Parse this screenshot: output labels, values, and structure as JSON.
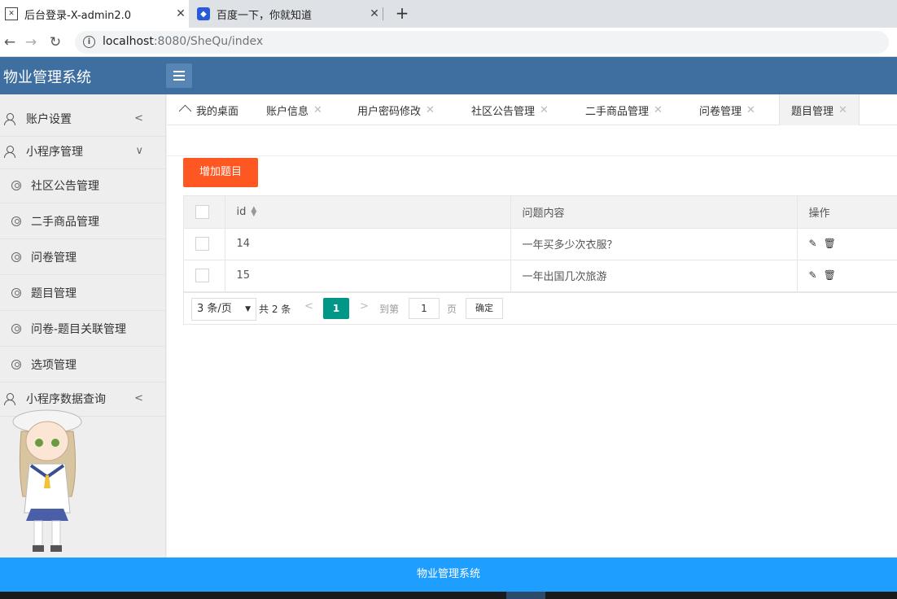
{
  "browser": {
    "tabs": [
      {
        "title": "后台登录-X-admin2.0",
        "icon": "x-icon",
        "active": true
      },
      {
        "title": "百度一下，你就知道",
        "icon": "paw-icon",
        "active": false
      }
    ],
    "close_glyph": "✕",
    "new_tab_glyph": "+",
    "url_host": "localhost",
    "url_path": ":8080/SheQu/index"
  },
  "header": {
    "title": "物业管理系统"
  },
  "sidebar": {
    "items": [
      {
        "label": "账户设置",
        "type": "group",
        "arrow": "<"
      },
      {
        "label": "小程序管理",
        "type": "group",
        "arrow": "∨"
      },
      {
        "label": "社区公告管理",
        "type": "sub"
      },
      {
        "label": "二手商品管理",
        "type": "sub"
      },
      {
        "label": "问卷管理",
        "type": "sub"
      },
      {
        "label": "题目管理",
        "type": "sub"
      },
      {
        "label": "问卷-题目关联管理",
        "type": "sub"
      },
      {
        "label": "选项管理",
        "type": "sub"
      },
      {
        "label": "小程序数据查询",
        "type": "group",
        "arrow": "<"
      }
    ]
  },
  "content_tabs": [
    {
      "label": "我的桌面",
      "closable": false
    },
    {
      "label": "账户信息",
      "closable": true
    },
    {
      "label": "用户密码修改",
      "closable": true
    },
    {
      "label": "社区公告管理",
      "closable": true
    },
    {
      "label": "二手商品管理",
      "closable": true
    },
    {
      "label": "问卷管理",
      "closable": true
    },
    {
      "label": "题目管理",
      "closable": true,
      "active": true
    }
  ],
  "toolbar": {
    "add_label": "增加题目"
  },
  "table": {
    "headers": [
      "id",
      "问题内容",
      "操作"
    ],
    "rows": [
      {
        "id": "14",
        "content": "一年买多少次衣服？"
      },
      {
        "id": "15",
        "content": "一年出国几次旅游"
      }
    ],
    "edit_glyph": "✎",
    "delete_glyph": "🗑"
  },
  "pager": {
    "page_size": "3 条/页",
    "total": "共 2 条",
    "prev": "<",
    "current": "1",
    "next": ">",
    "goto_label": "到第",
    "goto_value": "1",
    "page_label": "页",
    "confirm": "确定"
  },
  "footer": {
    "text": "物业管理系统"
  },
  "colors": {
    "header_bg": "#3e6fa0",
    "add_button": "#ff5722",
    "pager_current": "#009688",
    "footer_bg": "#1e9fff"
  }
}
